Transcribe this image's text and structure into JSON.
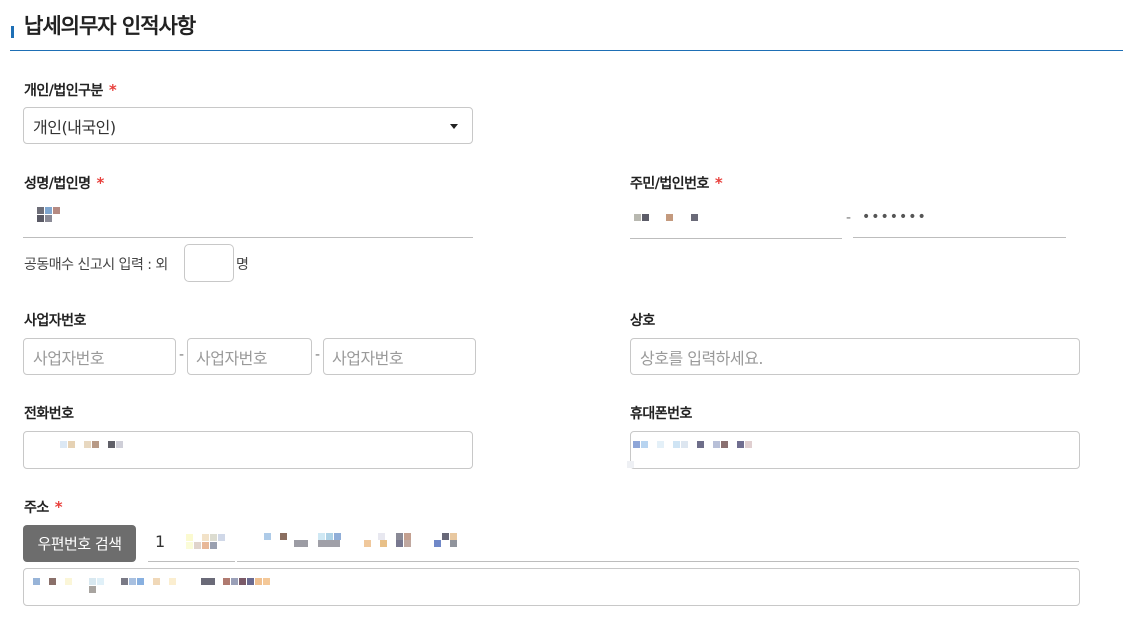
{
  "section": {
    "title": "납세의무자 인적사항"
  },
  "person_type": {
    "label": "개인/법인구분",
    "required_mark": "*",
    "selected": "개인(내국인)"
  },
  "name": {
    "label": "성명/법인명",
    "required_mark": "*",
    "joint_purchase_prefix": "공동매수 신고시 입력 : 외",
    "joint_purchase_suffix": "명",
    "joint_purchase_count": ""
  },
  "resident_number": {
    "label": "주민/법인번호",
    "required_mark": "*",
    "separator": "-",
    "masked_back": "•••••••"
  },
  "business_number": {
    "label": "사업자번호",
    "placeholder": "사업자번호",
    "separator": "-"
  },
  "company_name": {
    "label": "상호",
    "placeholder": "상호를 입력하세요."
  },
  "phone": {
    "label": "전화번호"
  },
  "mobile": {
    "label": "휴대폰번호"
  },
  "address": {
    "label": "주소",
    "required_mark": "*",
    "search_button": "우편번호 검색",
    "zip_prefix": "1"
  }
}
